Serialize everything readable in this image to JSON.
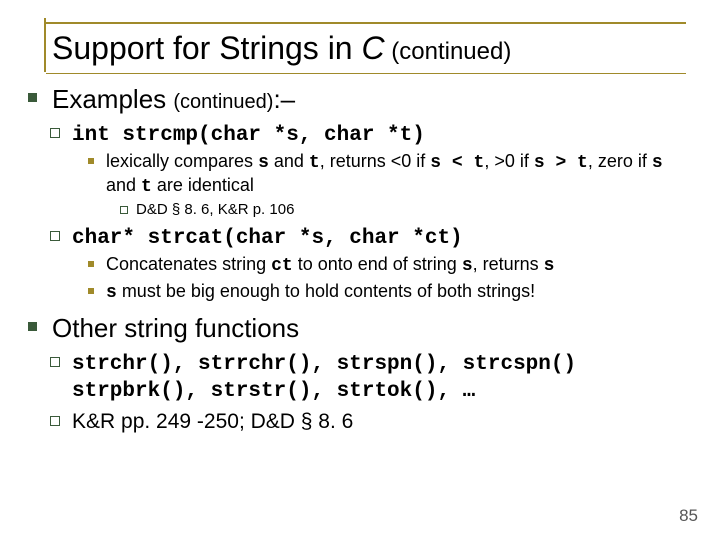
{
  "title": {
    "main": "Support for Strings in ",
    "italic": "C",
    "suffix": " (continued)"
  },
  "sections": [
    {
      "heading_plain": "Examples ",
      "heading_suffix": "(continued)",
      "heading_tail": ":–",
      "items": [
        {
          "code": "int strcmp(char *s, char *t)",
          "subs": [
            {
              "pre": "lexically compares ",
              "c1": "s",
              "mid1": " and ",
              "c2": "t",
              "mid2": ", returns <0 if ",
              "c3": "s < t",
              "mid3": ", >0 if ",
              "c4": "s > t",
              "mid4": ", zero if ",
              "c5": "s",
              "mid5": " and ",
              "c6": "t",
              "tail": " are identical",
              "refs": [
                "D&D § 8. 6, K&R p. 106"
              ]
            }
          ]
        },
        {
          "code": "char* strcat(char *s, char *ct)",
          "subs": [
            {
              "pre": "Concatenates string ",
              "c1": "ct",
              "mid1": " to onto end of string ",
              "c2": "s",
              "mid2": ", returns ",
              "c3": "s",
              "tail": ""
            },
            {
              "pre": "",
              "c1": "s",
              "mid1": " must be big enough to hold contents of both strings!",
              "tail": ""
            }
          ]
        }
      ]
    },
    {
      "heading_plain": "Other string functions",
      "items2": [
        {
          "line1": "strchr(), strrchr(), strspn(), strcspn()",
          "line2": "strpbrk(), strstr(), strtok(), …"
        },
        {
          "plain": "K&R pp. 249 -250; D&D § 8. 6"
        }
      ]
    }
  ],
  "page": "85"
}
